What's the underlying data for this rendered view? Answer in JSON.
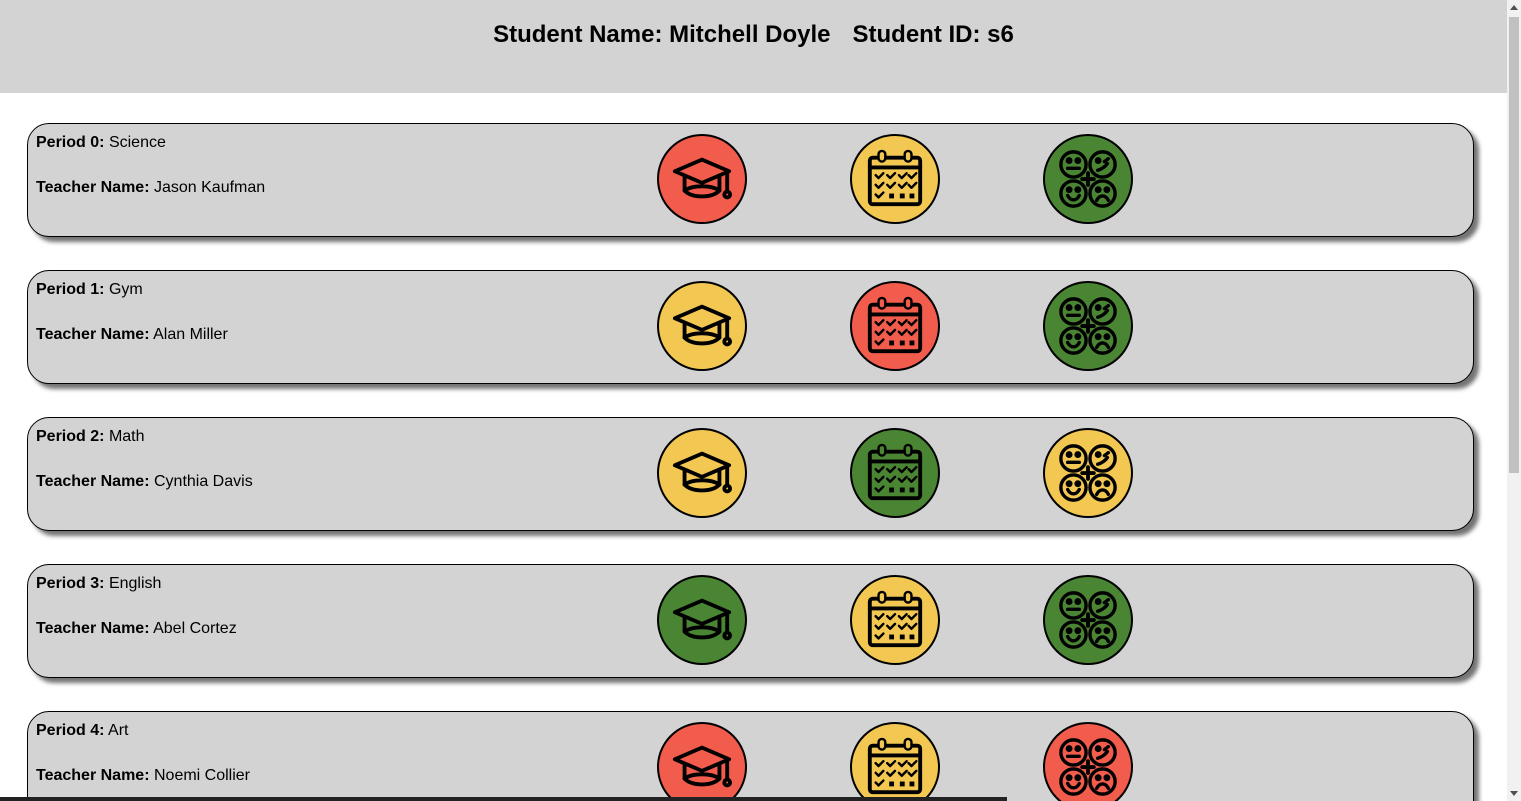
{
  "header": {
    "name_label": "Student Name:",
    "name": "Mitchell Doyle",
    "id_label": "Student ID:",
    "id": "s6"
  },
  "labels": {
    "period": "Period",
    "teacher": "Teacher Name:"
  },
  "status_colors": {
    "red": "#f25c4c",
    "yellow": "#f3c852",
    "green": "#4a8533"
  },
  "icons": [
    "graduation-cap-icon",
    "calendar-icon",
    "emotion-faces-icon"
  ],
  "periods": [
    {
      "number": "0:",
      "subject": "Science",
      "teacher": "Jason Kaufman",
      "status": [
        "red",
        "yellow",
        "green"
      ]
    },
    {
      "number": "1:",
      "subject": "Gym",
      "teacher": "Alan Miller",
      "status": [
        "yellow",
        "red",
        "green"
      ]
    },
    {
      "number": "2:",
      "subject": "Math",
      "teacher": "Cynthia Davis",
      "status": [
        "yellow",
        "green",
        "yellow"
      ]
    },
    {
      "number": "3:",
      "subject": "English",
      "teacher": "Abel Cortez",
      "status": [
        "green",
        "yellow",
        "green"
      ]
    },
    {
      "number": "4:",
      "subject": "Art",
      "teacher": "Noemi Collier",
      "status": [
        "red",
        "yellow",
        "red"
      ]
    }
  ]
}
